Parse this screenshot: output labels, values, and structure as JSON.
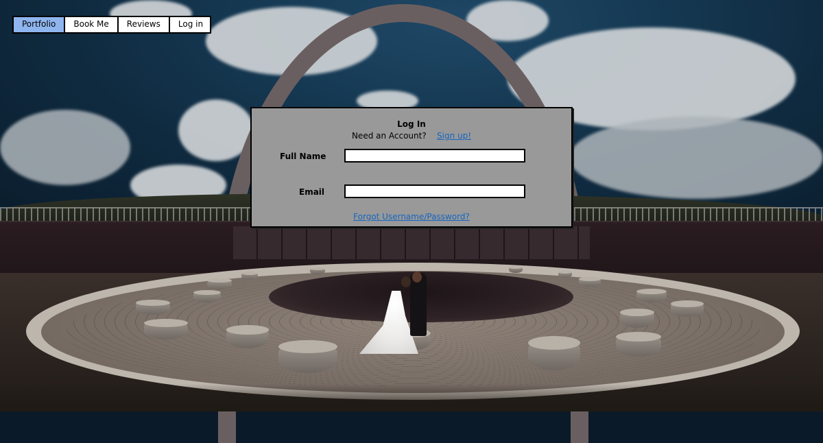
{
  "nav": {
    "items": [
      {
        "label": "Portfolio",
        "active": true
      },
      {
        "label": "Book Me",
        "active": false
      },
      {
        "label": "Reviews",
        "active": false
      },
      {
        "label": "Log in",
        "active": false
      }
    ]
  },
  "login": {
    "title": "Log In",
    "need_account": "Need an Account?",
    "signup_link": "Sign up!",
    "fields": {
      "full_name": {
        "label": "Full Name",
        "value": "",
        "placeholder": ""
      },
      "email": {
        "label": "Email",
        "value": "",
        "placeholder": ""
      }
    },
    "forgot_link": "Forgot Username/Password?"
  },
  "colors": {
    "nav_active": "#8fb5ef",
    "panel_bg": "#999999",
    "link": "#1565c0"
  }
}
